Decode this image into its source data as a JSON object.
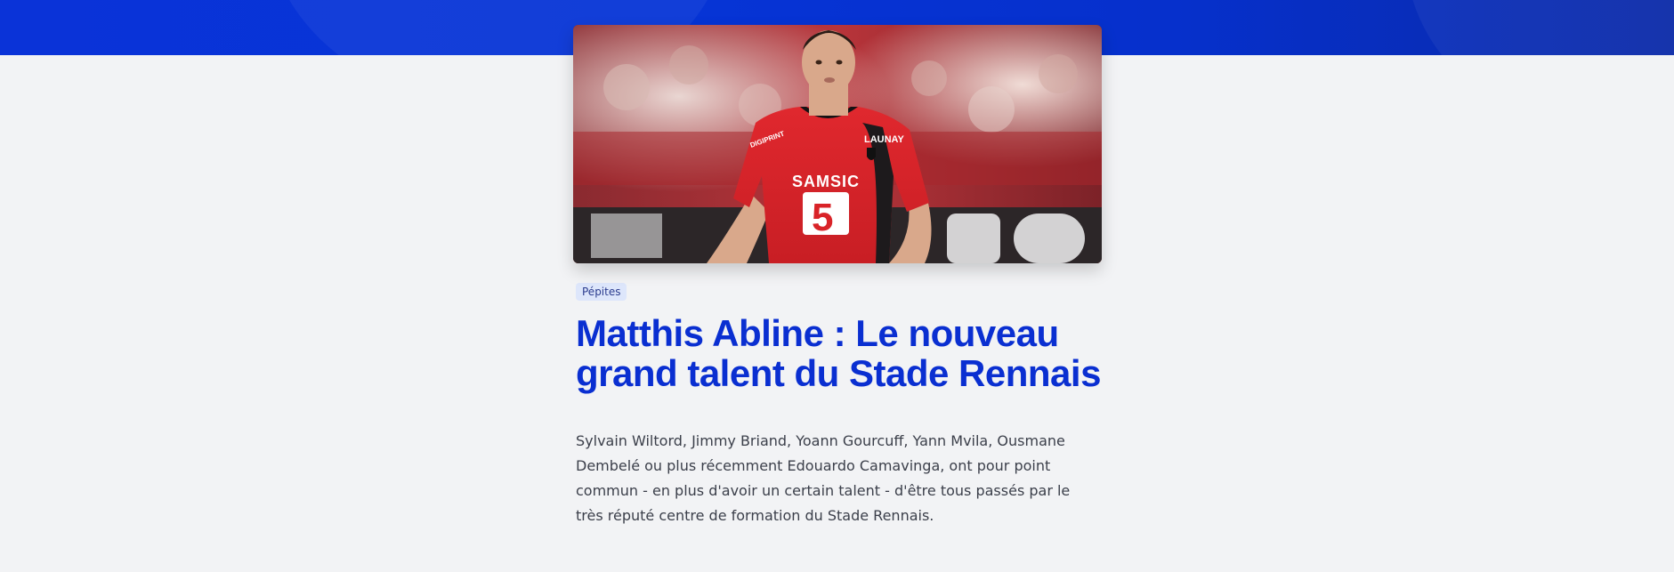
{
  "article": {
    "category": "Pépites",
    "title": "Matthis Abline : Le nouveau grand talent du Stade Rennais",
    "lead": "Sylvain Wiltord, Jimmy Briand, Yoann Gourcuff, Yann Mvila, Ousmane Dembelé ou plus récemment Edouardo Camavinga, ont pour point commun - en plus d'avoir un certain talent - d'être tous passés par le très réputé centre de formation du Stade Rennais."
  },
  "hero_photo": {
    "jersey_sponsor": "SAMSIC",
    "jersey_sleeve": "LAUNAY",
    "jersey_number": "5",
    "jersey_left_chest": "DIGIPRINT"
  },
  "colors": {
    "brand_blue": "#0a2fd1",
    "header_band": "#0634d6",
    "background": "#f2f3f5",
    "jersey_red": "#d92328"
  }
}
